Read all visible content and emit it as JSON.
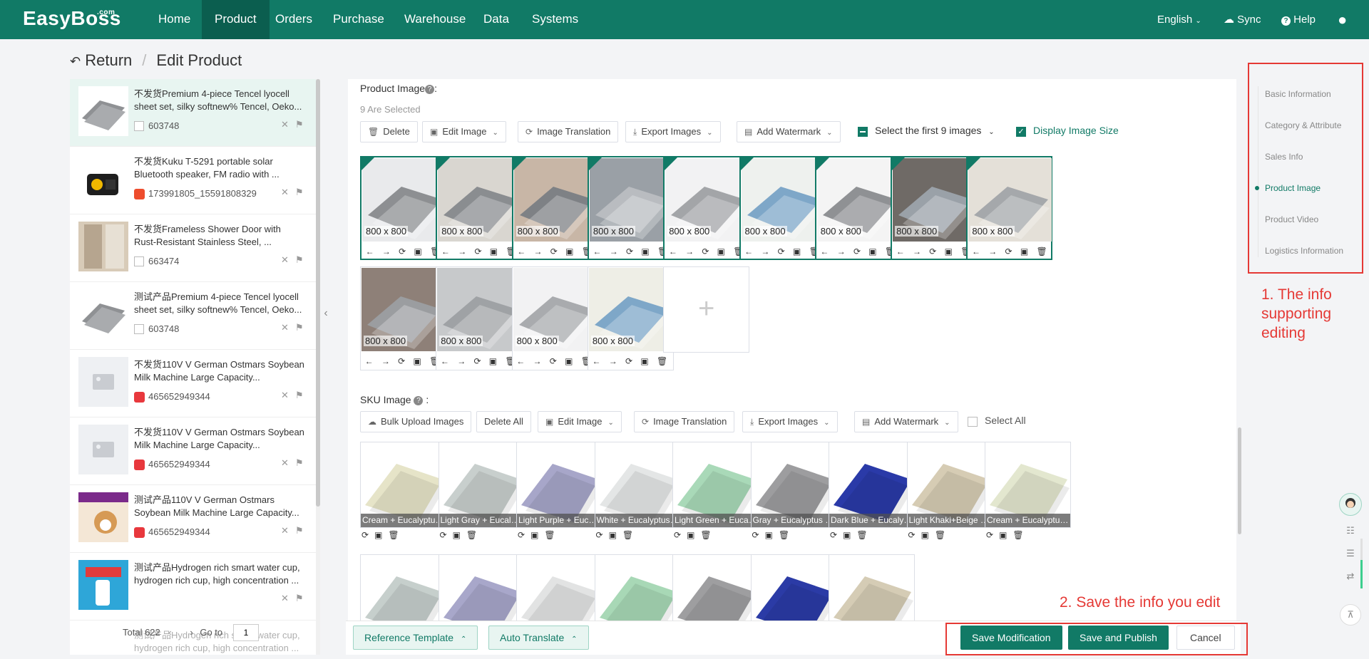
{
  "app": {
    "logo": "EasyBoss",
    "logo_sup": ".com"
  },
  "nav": {
    "items": [
      {
        "label": "Home",
        "active": false
      },
      {
        "label": "Product",
        "active": true
      },
      {
        "label": "Orders",
        "active": false
      },
      {
        "label": "Purchase",
        "active": false
      },
      {
        "label": "Warehouse",
        "active": false
      },
      {
        "label": "Data",
        "active": false
      },
      {
        "label": "Systems",
        "active": false
      }
    ],
    "language": "English",
    "sync": "Sync",
    "help": "Help"
  },
  "breadcrumb": {
    "return": "Return",
    "current": "Edit Product"
  },
  "product_list": [
    {
      "title": "不发货Premium 4-piece Tencel lyocell sheet set, silky softnew% Tencel, Oeko...",
      "id": "603748",
      "shop": "box"
    },
    {
      "title": "不发货Kuku T-5291 portable solar Bluetooth speaker, FM radio with ...",
      "id": "173991805_15591808329",
      "shop": "shopee"
    },
    {
      "title": "不发货Frameless Shower Door with Rust-Resistant Stainless Steel, ...",
      "id": "663474",
      "shop": "box"
    },
    {
      "title": "测试产品Premium 4-piece Tencel lyocell sheet set, silky softnew% Tencel, Oeko...",
      "id": "603748",
      "shop": "box"
    },
    {
      "title": "不发货110V V German Ostmars Soybean Milk Machine Large Capacity...",
      "id": "465652949344",
      "shop": "heart"
    },
    {
      "title": "不发货110V V German Ostmars Soybean Milk Machine Large Capacity...",
      "id": "465652949344",
      "shop": "heart"
    },
    {
      "title": "测试产品110V V German Ostmars Soybean Milk Machine Large Capacity...",
      "id": "465652949344",
      "shop": "heart"
    },
    {
      "title": "测试产品Hydrogen rich smart water cup, hydrogen rich cup, high concentration ...",
      "id": "",
      "shop": "none"
    },
    {
      "title": "测试产品Hydrogen rich smart water cup, hydrogen rich cup, high concentration ...",
      "id": "",
      "shop": "none"
    }
  ],
  "pager": {
    "total": "Total 622",
    "goto": "Go to",
    "page": "1"
  },
  "product_image": {
    "title": "Product Image",
    "selected": "9 Are Selected",
    "toolbar": {
      "delete": "Delete",
      "edit": "Edit Image",
      "translate": "Image Translation",
      "export": "Export Images",
      "watermark": "Add Watermark",
      "select_first": "Select the first 9 images",
      "display_size": "Display Image Size"
    },
    "size_label": "800 x 800"
  },
  "sku_image": {
    "title": "SKU Image",
    "toolbar": {
      "bulk": "Bulk Upload Images",
      "delete_all": "Delete All",
      "edit": "Edit Image",
      "translate": "Image Translation",
      "export": "Export Images",
      "watermark": "Add Watermark",
      "select_all": "Select All"
    },
    "items": [
      {
        "label": "Cream + Eucalyptus Lyocell",
        "color": "#e6e4c8"
      },
      {
        "label": "Light Gray + Eucalyptus Lyocell",
        "color": "#c8cfcd"
      },
      {
        "label": "Light Purple + Eucalyptus Lyocell",
        "color": "#a7a6c9"
      },
      {
        "label": "White + Eucalyptus Lyocell",
        "color": "#e4e6e6"
      },
      {
        "label": "Light Green + Eucalyptus Lyocell",
        "color": "#a9d9b8"
      },
      {
        "label": "Gray + Eucalyptus Lyocell",
        "color": "#9d9d9f"
      },
      {
        "label": "Dark Blue + Eucalyptus Lyocell",
        "color": "#2a3aa8"
      },
      {
        "label": "Light Khaki+Beige + Eucalyptus",
        "color": "#d6ccb4"
      },
      {
        "label": "Cream + Eucalyptus Lyocell",
        "color": "#e3e7cf"
      },
      {
        "label": "",
        "color": "#c6cfcc"
      },
      {
        "label": "",
        "color": "#a8a7ca"
      },
      {
        "label": "",
        "color": "#e2e3e3"
      },
      {
        "label": "",
        "color": "#a8d8b6"
      },
      {
        "label": "",
        "color": "#9e9ea0"
      },
      {
        "label": "",
        "color": "#2b3ba6"
      },
      {
        "label": "",
        "color": "#d5ccb5"
      }
    ]
  },
  "right_nav": {
    "items": [
      "Basic Information",
      "Category & Attribute",
      "Sales Info",
      "Product Image",
      "Product Video",
      "Logistics Information"
    ],
    "active": 3
  },
  "annotations": {
    "one": "1. The info supporting editing",
    "two": "2. Save the info you edit"
  },
  "bottom": {
    "ref_template": "Reference Template",
    "auto_translate": "Auto Translate",
    "save_mod": "Save Modification",
    "save_publish": "Save and Publish",
    "cancel": "Cancel"
  },
  "colors": {
    "brand": "#117a66",
    "annotation": "#e53935"
  }
}
